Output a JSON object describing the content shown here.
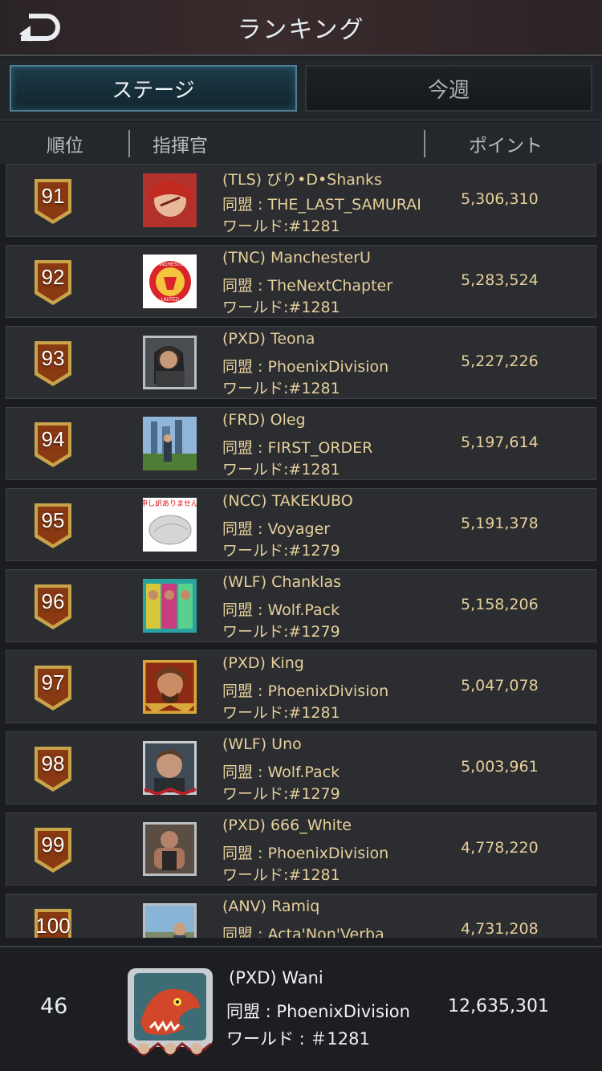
{
  "header": {
    "title": "ランキング",
    "back_icon": "back-arrow-icon"
  },
  "tabs": [
    {
      "label": "ステージ",
      "active": true
    },
    {
      "label": "今週",
      "active": false
    }
  ],
  "columns": {
    "rank": "順位",
    "commander": "指揮官",
    "points": "ポイント"
  },
  "colors": {
    "accent": "#4f7f93",
    "gold_text": "#e6cf9a",
    "badge": "#8a3a12"
  },
  "rows": [
    {
      "rank": "91",
      "name": "(TLS) びり•D•Shanks",
      "alliance": "同盟 : THE_LAST_SAMURAI",
      "world": "ワールド:#1281",
      "points": "5,306,310"
    },
    {
      "rank": "92",
      "name": "(TNC) ManchesterU",
      "alliance": "同盟 : TheNextChapter",
      "world": "ワールド:#1281",
      "points": "5,283,524"
    },
    {
      "rank": "93",
      "name": "(PXD) Teona",
      "alliance": "同盟 : PhoenixDivision",
      "world": "ワールド:#1281",
      "points": "5,227,226"
    },
    {
      "rank": "94",
      "name": "(FRD) Oleg",
      "alliance": "同盟 : FIRST_ORDER",
      "world": "ワールド:#1281",
      "points": "5,197,614"
    },
    {
      "rank": "95",
      "name": "(NCC) TAKEKUBO",
      "alliance": "同盟 : Voyager",
      "world": "ワールド:#1279",
      "points": "5,191,378"
    },
    {
      "rank": "96",
      "name": "(WLF) Chanklas",
      "alliance": "同盟 : Wolf.Pack",
      "world": "ワールド:#1279",
      "points": "5,158,206"
    },
    {
      "rank": "97",
      "name": "(PXD) King",
      "alliance": "同盟 : PhoenixDivision",
      "world": "ワールド:#1281",
      "points": "5,047,078"
    },
    {
      "rank": "98",
      "name": "(WLF) Uno",
      "alliance": "同盟 : Wolf.Pack",
      "world": "ワールド:#1279",
      "points": "5,003,961"
    },
    {
      "rank": "99",
      "name": "(PXD) 666_White",
      "alliance": "同盟 : PhoenixDivision",
      "world": "ワールド:#1281",
      "points": "4,778,220"
    },
    {
      "rank": "100",
      "name": "(ANV) Ramiq",
      "alliance": "同盟 : Acta'Non'Verba",
      "world": "",
      "points": "4,731,208"
    }
  ],
  "avatar_texts": {
    "manchester_top": "MANCHESTER",
    "manchester_bottom": "UNITED",
    "takekubo_caption": "申し訳ありません"
  },
  "self": {
    "rank": "46",
    "name": "(PXD)  Wani",
    "alliance": "同盟 : PhoenixDivision",
    "world": "ワールド : ＃1281",
    "points": "12,635,301"
  }
}
